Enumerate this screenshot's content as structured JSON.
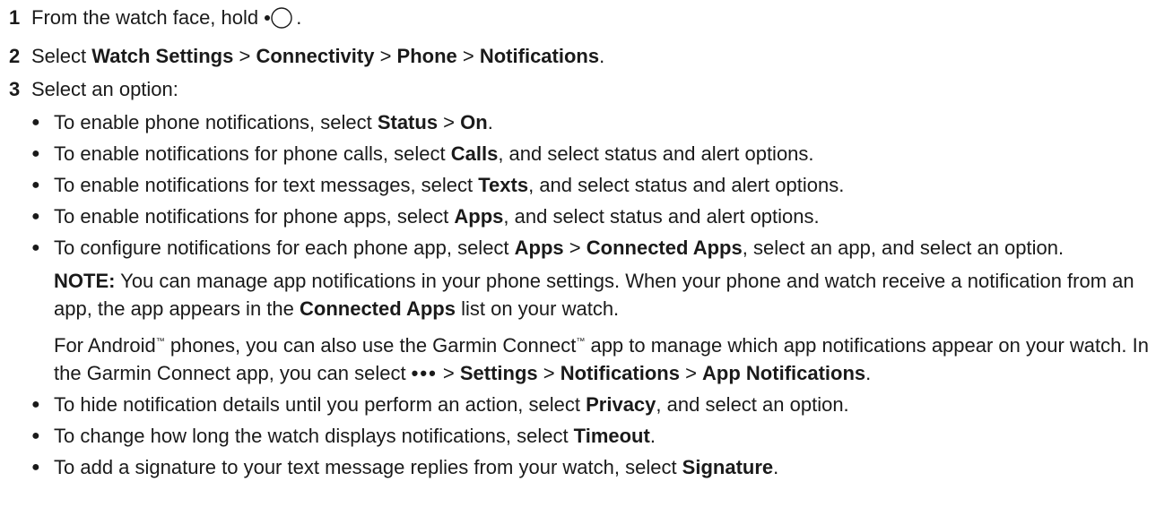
{
  "steps": [
    {
      "num": "1",
      "pre": "From the watch face, hold ",
      "post": "."
    },
    {
      "num": "2",
      "pre": "Select ",
      "b1": "Watch Settings",
      "s1": " > ",
      "b2": "Connectivity",
      "s2": " > ",
      "b3": "Phone",
      "s3": " > ",
      "b4": "Notifications",
      "post": "."
    },
    {
      "num": "3",
      "text": "Select an option:"
    }
  ],
  "bullets": {
    "status": {
      "pre": "To enable phone notifications, select ",
      "b1": "Status",
      "mid": " > ",
      "b2": "On",
      "post": "."
    },
    "calls": {
      "pre": "To enable notifications for phone calls, select ",
      "b1": "Calls",
      "post": ", and select status and alert options."
    },
    "texts": {
      "pre": "To enable notifications for text messages, select ",
      "b1": "Texts",
      "post": ", and select status and alert options."
    },
    "apps": {
      "pre": "To enable notifications for phone apps, select ",
      "b1": "Apps",
      "post": ", and select status and alert options."
    },
    "configure": {
      "pre": "To configure notifications for each phone app, select ",
      "b1": "Apps",
      "mid": " > ",
      "b2": "Connected Apps",
      "post": ", select an app, and select an option."
    },
    "privacy": {
      "pre": "To hide notification details until you perform an action, select ",
      "b1": "Privacy",
      "post": ", and select an option."
    },
    "timeout": {
      "pre": "To change how long the watch displays notifications, select ",
      "b1": "Timeout",
      "post": "."
    },
    "signature": {
      "pre": "To add a signature to your text message replies from your watch, select ",
      "b1": "Signature",
      "post": "."
    }
  },
  "note": {
    "label": "NOTE:",
    "pre": " You can manage app notifications in your phone settings. When your phone and watch receive a notification from an app, the app appears in the ",
    "b1": "Connected Apps",
    "post": " list on your watch."
  },
  "android": {
    "t1": "For Android",
    "tm": "™",
    "t2": " phones, you can also use the Garmin Connect",
    "t3": " app to manage which app notifications appear on your watch. In the Garmin Connect app, you can select ",
    "more": "•••",
    "s1": " > ",
    "b1": "Settings",
    "s2": " > ",
    "b2": "Notifications",
    "s3": " > ",
    "b3": "App Notifications",
    "post": "."
  },
  "icons": {
    "hold_button": "watch-button-icon",
    "more": "more-icon"
  }
}
